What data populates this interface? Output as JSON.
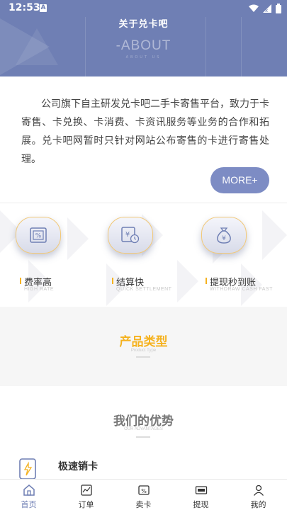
{
  "status_bar": {
    "time": "12:53",
    "notification_letter": "A"
  },
  "header": {
    "title": "关于兑卡吧",
    "subtitle": "-ABOUT",
    "subtitle_small": "ABOUT US"
  },
  "about": {
    "text": "公司旗下自主研发兑卡吧二手卡寄售平台，致力于卡寄售、卡兑换、卡消费、卡资讯服务等业务的合作和拓展。兑卡吧网暂时只针对网站公布寄售的卡进行寄售处理。",
    "more_label": "MORE+"
  },
  "features": [
    {
      "label": "费率高",
      "en": "HIGH RATE",
      "icon": "percent-card-icon"
    },
    {
      "label": "结算快",
      "en": "QUICK SETTLEMENT",
      "icon": "yen-clock-icon"
    },
    {
      "label": "提现秒到账",
      "en": "WITHDRAW CASH FAST",
      "icon": "money-bag-icon"
    }
  ],
  "product_section": {
    "title": "产品类型",
    "en": "Product Type"
  },
  "advantages_section": {
    "title": "我们的优势",
    "en": "OUR ADVANTAGES",
    "items": [
      {
        "label": "极速销卡",
        "icon": "fast-sell-card-icon"
      }
    ]
  },
  "bottom_nav": [
    {
      "label": "首页",
      "icon": "home-icon",
      "active": true
    },
    {
      "label": "订单",
      "icon": "orders-icon",
      "active": false
    },
    {
      "label": "卖卡",
      "icon": "sell-card-icon",
      "active": false
    },
    {
      "label": "提现",
      "icon": "withdraw-icon",
      "active": false
    },
    {
      "label": "我的",
      "icon": "user-icon",
      "active": false
    }
  ],
  "colors": {
    "primary": "#6f7fb4",
    "accent": "#f5b21f",
    "button": "#7d8cc4"
  }
}
